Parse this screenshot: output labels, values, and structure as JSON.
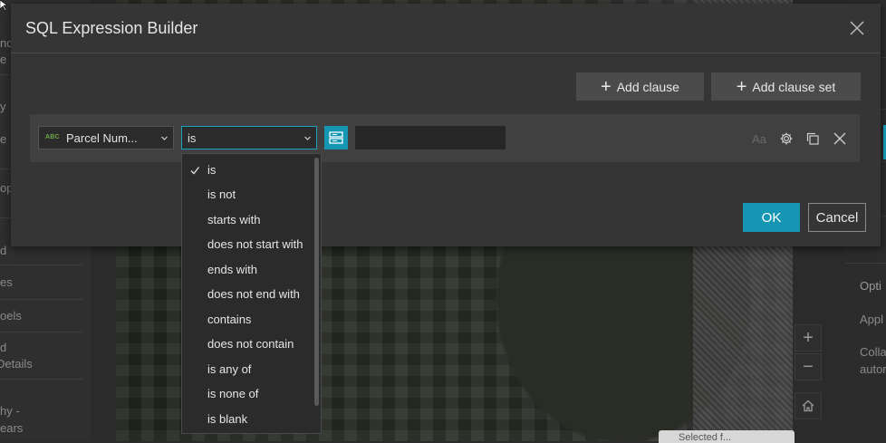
{
  "background": {
    "left_panel": [
      "nc",
      "e",
      "y",
      "e",
      "op",
      "d",
      "es",
      "oels",
      "d",
      "Details",
      "hy -",
      "ears"
    ],
    "right_panel": [
      "Opti",
      "Appl",
      "Colla",
      "autor"
    ],
    "map_tooltip": "Selected f..."
  },
  "dialog": {
    "title": "SQL Expression Builder",
    "add_clause_label": "Add clause",
    "add_clause_set_label": "Add clause set",
    "clause": {
      "field_type_badge": "ABC",
      "field_label": "Parcel Num...",
      "operator_label": "is",
      "value": "",
      "case_sensitive_label": "Aa"
    },
    "ok_label": "OK",
    "cancel_label": "Cancel"
  },
  "operator_dropdown": {
    "selected": "is",
    "options": [
      "is",
      "is not",
      "starts with",
      "does not start with",
      "ends with",
      "does not end with",
      "contains",
      "does not contain",
      "is any of",
      "is none of",
      "is blank"
    ]
  },
  "colors": {
    "accent": "#1596b2",
    "dialog_bg": "#353535",
    "row_bg": "#404040"
  }
}
